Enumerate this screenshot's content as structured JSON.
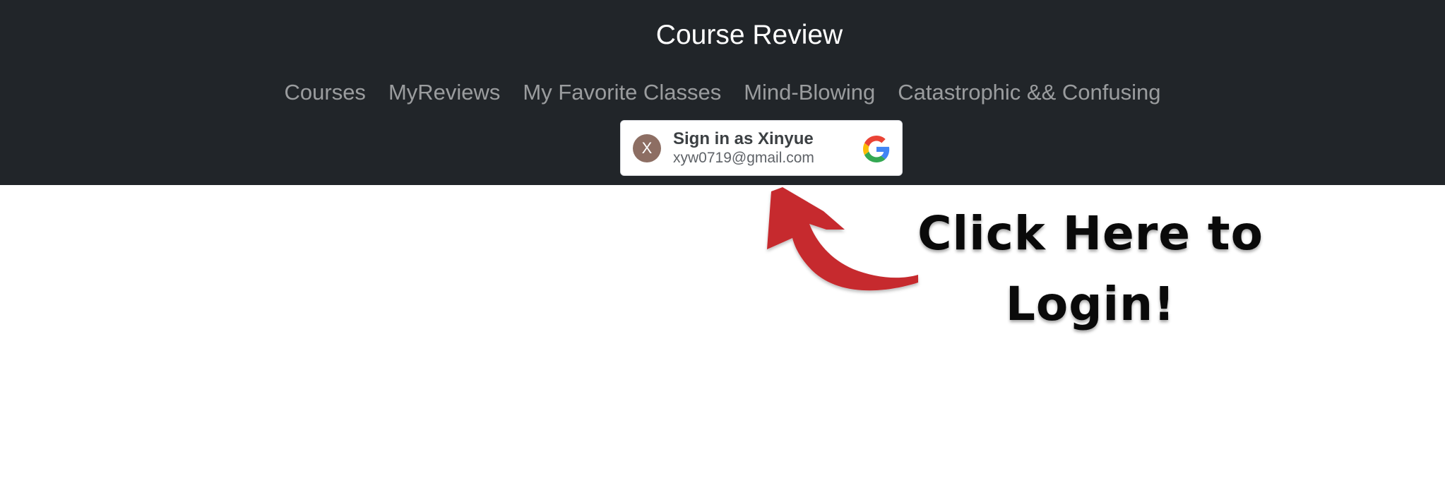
{
  "navbar": {
    "brand": "Course Review",
    "links": [
      {
        "label": "Courses"
      },
      {
        "label": "MyReviews"
      },
      {
        "label": "My Favorite Classes"
      },
      {
        "label": "Mind-Blowing"
      },
      {
        "label": "Catastrophic && Confusing"
      }
    ]
  },
  "signin": {
    "avatar_initial": "X",
    "title": "Sign in as Xinyue",
    "email": "xyw0719@gmail.com",
    "icon": "google-g-icon"
  },
  "hint": {
    "line1": "Click Here to",
    "line2": "Login!",
    "arrow_color": "#c62a2f"
  },
  "colors": {
    "navbar_bg": "#212529",
    "nav_link": "#9a9da0",
    "avatar_bg": "#8d6e63"
  }
}
